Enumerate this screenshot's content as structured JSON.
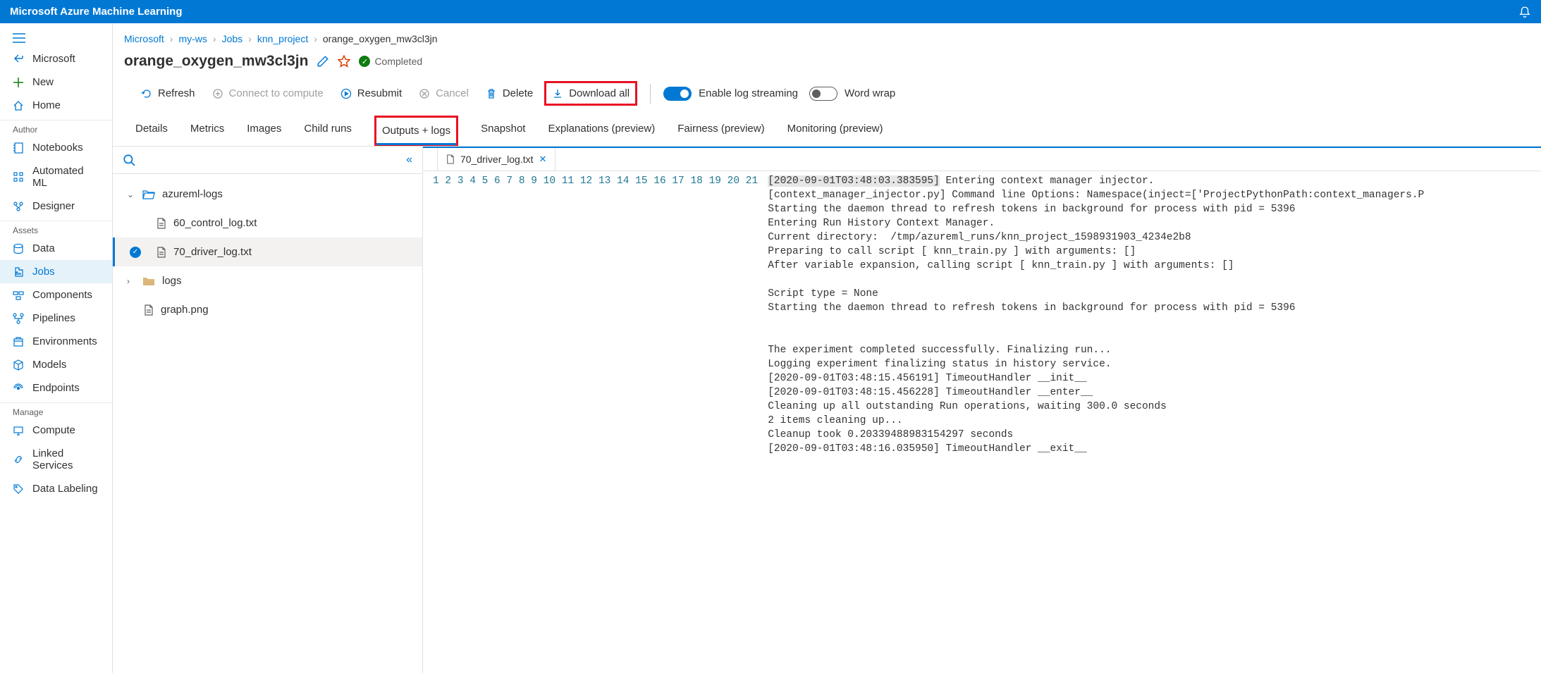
{
  "app_title": "Microsoft Azure Machine Learning",
  "leftnav": {
    "back_label": "Microsoft",
    "new_label": "New",
    "home_label": "Home",
    "sections": {
      "author": "Author",
      "assets": "Assets",
      "manage": "Manage"
    },
    "items": {
      "notebooks": "Notebooks",
      "automl": "Automated ML",
      "designer": "Designer",
      "data": "Data",
      "jobs": "Jobs",
      "components": "Components",
      "pipelines": "Pipelines",
      "environments": "Environments",
      "models": "Models",
      "endpoints": "Endpoints",
      "compute": "Compute",
      "linked": "Linked Services",
      "labeling": "Data Labeling"
    }
  },
  "breadcrumb": {
    "root": "Microsoft",
    "ws": "my-ws",
    "jobs": "Jobs",
    "project": "knn_project",
    "current": "orange_oxygen_mw3cl3jn"
  },
  "job": {
    "title": "orange_oxygen_mw3cl3jn",
    "status": "Completed"
  },
  "toolbar": {
    "refresh": "Refresh",
    "connect": "Connect to compute",
    "resubmit": "Resubmit",
    "cancel": "Cancel",
    "delete": "Delete",
    "download_all": "Download all",
    "enable_log_streaming": "Enable log streaming",
    "word_wrap": "Word wrap"
  },
  "tabs": {
    "details": "Details",
    "metrics": "Metrics",
    "images": "Images",
    "childruns": "Child runs",
    "outputs": "Outputs + logs",
    "snapshot": "Snapshot",
    "explanations": "Explanations (preview)",
    "fairness": "Fairness (preview)",
    "monitoring": "Monitoring (preview)"
  },
  "filetree": {
    "azureml_logs": "azureml-logs",
    "f60": "60_control_log.txt",
    "f70": "70_driver_log.txt",
    "logs": "logs",
    "graph": "graph.png"
  },
  "editor": {
    "tab_label": "70_driver_log.txt",
    "lines": [
      "[2020-09-01T03:48:03.383595] Entering context manager injector.",
      "[context_manager_injector.py] Command line Options: Namespace(inject=['ProjectPythonPath:context_managers.P",
      "Starting the daemon thread to refresh tokens in background for process with pid = 5396",
      "Entering Run History Context Manager.",
      "Current directory:  /tmp/azureml_runs/knn_project_1598931903_4234e2b8",
      "Preparing to call script [ knn_train.py ] with arguments: []",
      "After variable expansion, calling script [ knn_train.py ] with arguments: []",
      "",
      "Script type = None",
      "Starting the daemon thread to refresh tokens in background for process with pid = 5396",
      "",
      "",
      "The experiment completed successfully. Finalizing run...",
      "Logging experiment finalizing status in history service.",
      "[2020-09-01T03:48:15.456191] TimeoutHandler __init__",
      "[2020-09-01T03:48:15.456228] TimeoutHandler __enter__",
      "Cleaning up all outstanding Run operations, waiting 300.0 seconds",
      "2 items cleaning up...",
      "Cleanup took 0.20339488983154297 seconds",
      "[2020-09-01T03:48:16.035950] TimeoutHandler __exit__",
      ""
    ]
  }
}
